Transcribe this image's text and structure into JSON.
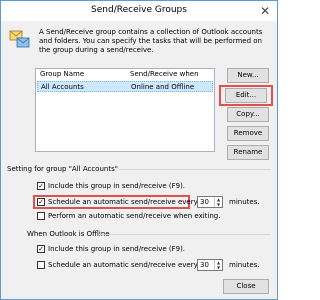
{
  "window": {
    "title": "Send/Receive Groups",
    "close_glyph": "✕"
  },
  "description": "A Send/Receive group contains a collection of Outlook accounts and folders. You can specify the tasks that will be performed on the group during a send/receive.",
  "list": {
    "columns": [
      "Group Name",
      "Send/Receive when"
    ],
    "rows": [
      {
        "name": "All Accounts",
        "when": "Online and Offline"
      }
    ]
  },
  "buttons": {
    "new": "New...",
    "edit": "Edit...",
    "copy": "Copy...",
    "remove": "Remove",
    "rename": "Rename",
    "close": "Close"
  },
  "setting_group": {
    "title": "Setting for group \"All Accounts\"",
    "include_label": "Include this group in send/receive (F9).",
    "include_checked": true,
    "schedule_label": "Schedule an automatic send/receive every",
    "schedule_checked": true,
    "schedule_value": "30",
    "schedule_unit": "minutes.",
    "exit_label": "Perform an automatic send/receive when exiting.",
    "exit_checked": false
  },
  "offline_group": {
    "title": "When Outlook is Offline",
    "include_label": "Include this group in send/receive (F9).",
    "include_checked": true,
    "schedule_label": "Schedule an automatic send/receive every",
    "schedule_checked": false,
    "schedule_value": "30",
    "schedule_unit": "minutes."
  },
  "colors": {
    "highlight_box": "#e05050",
    "selection": "#cde8ff",
    "window_border": "#5b9bd5"
  },
  "icons": {
    "dialog_icon": "send-receive-icon",
    "check_glyph": "✓"
  }
}
